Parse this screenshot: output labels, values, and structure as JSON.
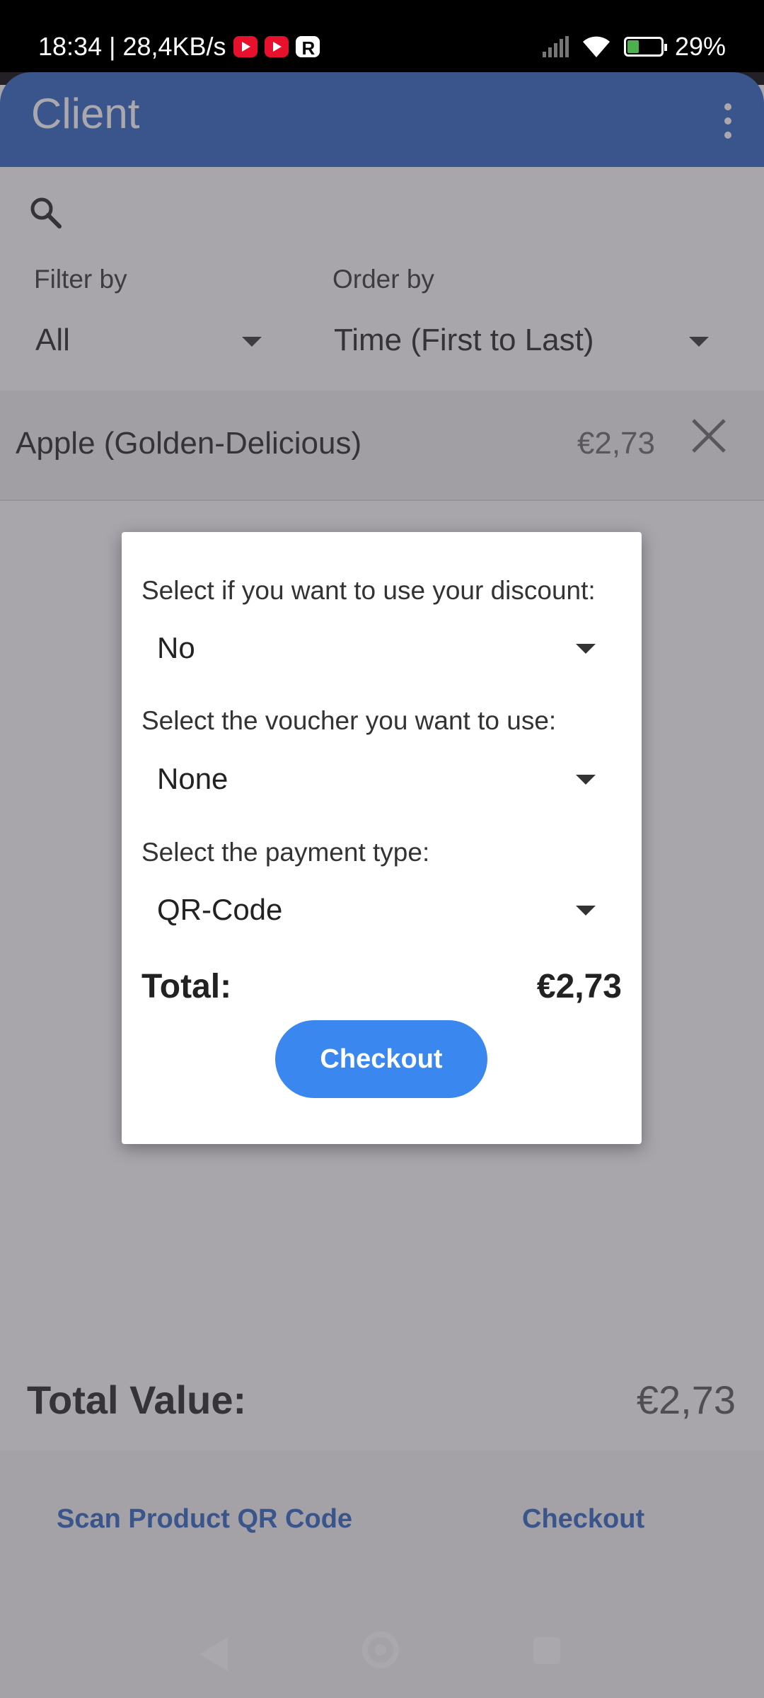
{
  "status_bar": {
    "time_speed": "18:34 | 28,4KB/s",
    "battery": "29%",
    "icons": [
      "youtube-icon",
      "youtube-icon",
      "r-app-icon",
      "signal-icon",
      "wifi-icon",
      "battery-charging-icon"
    ]
  },
  "appbar": {
    "title": "Client",
    "menu_icon": "more-vert-icon"
  },
  "filters": {
    "filter_label": "Filter by",
    "filter_value": "All",
    "order_label": "Order by",
    "order_value": "Time (First to Last)"
  },
  "items": [
    {
      "name": "Apple (Golden-Delicious)",
      "price": "€2,73"
    }
  ],
  "summary": {
    "total_label": "Total Value:",
    "total_value": "€2,73"
  },
  "bottom_actions": {
    "scan_label": "Scan Product QR Code",
    "checkout_label": "Checkout"
  },
  "dialog": {
    "discount_label": "Select if you want to use your discount:",
    "discount_value": "No",
    "voucher_label": "Select the voucher you want to use:",
    "voucher_value": "None",
    "payment_label": "Select the payment type:",
    "payment_value": "QR-Code",
    "total_label": "Total:",
    "total_value": "€2,73",
    "checkout_label": "Checkout"
  },
  "colors": {
    "primary": "#2b63c1",
    "checkout_button": "#3a87f0",
    "scrim": "rgba(75,70,80,0.47)"
  }
}
